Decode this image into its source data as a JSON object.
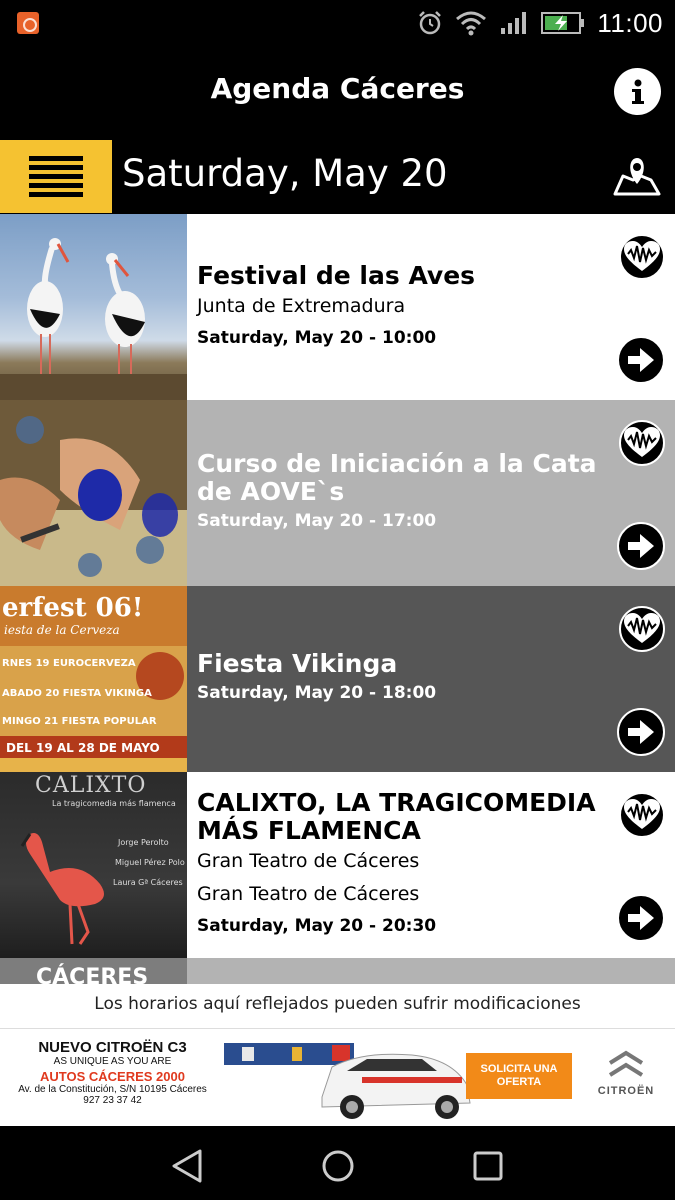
{
  "status_bar": {
    "time": "11:00",
    "icons": [
      "app-notification-icon",
      "alarm-icon",
      "wifi-icon",
      "signal-icon",
      "battery-charging-icon"
    ]
  },
  "header": {
    "title": "Agenda Cáceres",
    "info_icon": "info-icon"
  },
  "date_bar": {
    "menu_icon": "menu-icon",
    "date": "Saturday, May 20",
    "map_icon": "map-icon"
  },
  "events": [
    {
      "title": "Festival de las Aves",
      "organizer": "Junta de Extremadura",
      "venue": "",
      "datetime": "Saturday, May 20 - 10:00",
      "image": "storks"
    },
    {
      "title": "Curso de Iniciación a la Cata de AOVE`s",
      "organizer": "",
      "venue": "",
      "datetime": "Saturday, May 20 - 17:00",
      "image": "oil-tasting"
    },
    {
      "title": "Fiesta Vikinga",
      "organizer": "",
      "venue": "",
      "datetime": "Saturday, May 20 - 18:00",
      "image": "beer-fest-poster",
      "poster_text": {
        "title": "erfest 06!",
        "subtitle": "iesta de la Cerveza",
        "lines": [
          "RNES 19 EUROCERVEZA",
          "ABADO 20 FIESTA VIKINGA",
          "MINGO 21 FIESTA POPULAR"
        ],
        "footer": "DEL 19 AL 28 DE MAYO"
      }
    },
    {
      "title": "CALIXTO, LA TRAGICOMEDIA MÁS FLAMENCA",
      "organizer": "Gran Teatro de Cáceres",
      "venue": "Gran Teatro de Cáceres",
      "datetime": "Saturday, May 20 - 20:30",
      "image": "flamingo-poster",
      "poster_text": {
        "title": "CALIXTO",
        "subtitle": "La tragicomedia más flamenca",
        "credits": [
          "Jorge Perolto",
          "Miguel Pérez Polo",
          "Laura Gª Cáceres"
        ]
      }
    },
    {
      "title": "",
      "organizer": "",
      "venue": "",
      "datetime": "",
      "image": "caceres",
      "poster_text": {
        "title": "CÁCERES"
      }
    }
  ],
  "footer_notice": "Los horarios aquí reflejados pueden sufrir modificaciones",
  "ad": {
    "line1": "NUEVO CITROËN C3",
    "line2": "AS UNIQUE AS YOU ARE",
    "line3": "AUTOS CÁCERES 2000",
    "line4": "Av. de la Constitución, S/N 10195 Cáceres",
    "line5": "927 23 37 42",
    "cta": "SOLICITA UNA OFERTA",
    "brand": "CITROËN"
  },
  "nav_bar": {
    "icons": [
      "back-icon",
      "home-icon",
      "recents-icon"
    ]
  },
  "colors": {
    "accent_yellow": "#f5c231",
    "row_white": "#ffffff",
    "row_light_gray": "#b3b3b3",
    "row_dark_gray": "#565656",
    "ad_orange": "#f28a18",
    "ad_red": "#e03a1f"
  }
}
